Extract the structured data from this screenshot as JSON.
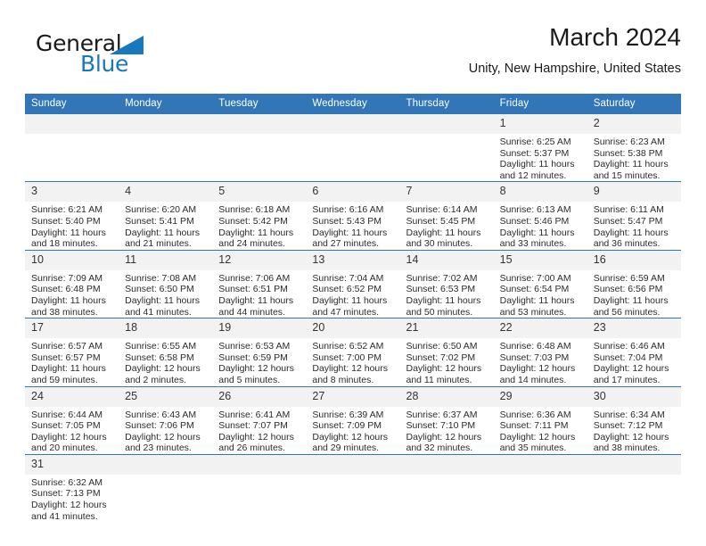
{
  "brand": {
    "name_top": "General",
    "name_bottom": "Blue",
    "flag_icon": "triangle-flag-icon",
    "color_primary": "#1878be",
    "color_text": "#1a1a1a"
  },
  "header": {
    "title": "March 2024",
    "subtitle": "Unity, New Hampshire, United States"
  },
  "theme": {
    "header_bg": "#3276b8",
    "daynum_bg": "#f2f2f2",
    "grid_line": "#3276b8"
  },
  "calendar": {
    "weekdays": [
      "Sunday",
      "Monday",
      "Tuesday",
      "Wednesday",
      "Thursday",
      "Friday",
      "Saturday"
    ],
    "labels": {
      "sunrise": "Sunrise:",
      "sunset": "Sunset:",
      "daylight": "Daylight:"
    },
    "weeks": [
      [
        {
          "day": "",
          "blank": true
        },
        {
          "day": "",
          "blank": true
        },
        {
          "day": "",
          "blank": true
        },
        {
          "day": "",
          "blank": true
        },
        {
          "day": "",
          "blank": true
        },
        {
          "day": "1",
          "sunrise": "Sunrise: 6:25 AM",
          "sunset": "Sunset: 5:37 PM",
          "daylight": "Daylight: 11 hours and 12 minutes."
        },
        {
          "day": "2",
          "sunrise": "Sunrise: 6:23 AM",
          "sunset": "Sunset: 5:38 PM",
          "daylight": "Daylight: 11 hours and 15 minutes."
        }
      ],
      [
        {
          "day": "3",
          "sunrise": "Sunrise: 6:21 AM",
          "sunset": "Sunset: 5:40 PM",
          "daylight": "Daylight: 11 hours and 18 minutes."
        },
        {
          "day": "4",
          "sunrise": "Sunrise: 6:20 AM",
          "sunset": "Sunset: 5:41 PM",
          "daylight": "Daylight: 11 hours and 21 minutes."
        },
        {
          "day": "5",
          "sunrise": "Sunrise: 6:18 AM",
          "sunset": "Sunset: 5:42 PM",
          "daylight": "Daylight: 11 hours and 24 minutes."
        },
        {
          "day": "6",
          "sunrise": "Sunrise: 6:16 AM",
          "sunset": "Sunset: 5:43 PM",
          "daylight": "Daylight: 11 hours and 27 minutes."
        },
        {
          "day": "7",
          "sunrise": "Sunrise: 6:14 AM",
          "sunset": "Sunset: 5:45 PM",
          "daylight": "Daylight: 11 hours and 30 minutes."
        },
        {
          "day": "8",
          "sunrise": "Sunrise: 6:13 AM",
          "sunset": "Sunset: 5:46 PM",
          "daylight": "Daylight: 11 hours and 33 minutes."
        },
        {
          "day": "9",
          "sunrise": "Sunrise: 6:11 AM",
          "sunset": "Sunset: 5:47 PM",
          "daylight": "Daylight: 11 hours and 36 minutes."
        }
      ],
      [
        {
          "day": "10",
          "sunrise": "Sunrise: 7:09 AM",
          "sunset": "Sunset: 6:48 PM",
          "daylight": "Daylight: 11 hours and 38 minutes."
        },
        {
          "day": "11",
          "sunrise": "Sunrise: 7:08 AM",
          "sunset": "Sunset: 6:50 PM",
          "daylight": "Daylight: 11 hours and 41 minutes."
        },
        {
          "day": "12",
          "sunrise": "Sunrise: 7:06 AM",
          "sunset": "Sunset: 6:51 PM",
          "daylight": "Daylight: 11 hours and 44 minutes."
        },
        {
          "day": "13",
          "sunrise": "Sunrise: 7:04 AM",
          "sunset": "Sunset: 6:52 PM",
          "daylight": "Daylight: 11 hours and 47 minutes."
        },
        {
          "day": "14",
          "sunrise": "Sunrise: 7:02 AM",
          "sunset": "Sunset: 6:53 PM",
          "daylight": "Daylight: 11 hours and 50 minutes."
        },
        {
          "day": "15",
          "sunrise": "Sunrise: 7:00 AM",
          "sunset": "Sunset: 6:54 PM",
          "daylight": "Daylight: 11 hours and 53 minutes."
        },
        {
          "day": "16",
          "sunrise": "Sunrise: 6:59 AM",
          "sunset": "Sunset: 6:56 PM",
          "daylight": "Daylight: 11 hours and 56 minutes."
        }
      ],
      [
        {
          "day": "17",
          "sunrise": "Sunrise: 6:57 AM",
          "sunset": "Sunset: 6:57 PM",
          "daylight": "Daylight: 11 hours and 59 minutes."
        },
        {
          "day": "18",
          "sunrise": "Sunrise: 6:55 AM",
          "sunset": "Sunset: 6:58 PM",
          "daylight": "Daylight: 12 hours and 2 minutes."
        },
        {
          "day": "19",
          "sunrise": "Sunrise: 6:53 AM",
          "sunset": "Sunset: 6:59 PM",
          "daylight": "Daylight: 12 hours and 5 minutes."
        },
        {
          "day": "20",
          "sunrise": "Sunrise: 6:52 AM",
          "sunset": "Sunset: 7:00 PM",
          "daylight": "Daylight: 12 hours and 8 minutes."
        },
        {
          "day": "21",
          "sunrise": "Sunrise: 6:50 AM",
          "sunset": "Sunset: 7:02 PM",
          "daylight": "Daylight: 12 hours and 11 minutes."
        },
        {
          "day": "22",
          "sunrise": "Sunrise: 6:48 AM",
          "sunset": "Sunset: 7:03 PM",
          "daylight": "Daylight: 12 hours and 14 minutes."
        },
        {
          "day": "23",
          "sunrise": "Sunrise: 6:46 AM",
          "sunset": "Sunset: 7:04 PM",
          "daylight": "Daylight: 12 hours and 17 minutes."
        }
      ],
      [
        {
          "day": "24",
          "sunrise": "Sunrise: 6:44 AM",
          "sunset": "Sunset: 7:05 PM",
          "daylight": "Daylight: 12 hours and 20 minutes."
        },
        {
          "day": "25",
          "sunrise": "Sunrise: 6:43 AM",
          "sunset": "Sunset: 7:06 PM",
          "daylight": "Daylight: 12 hours and 23 minutes."
        },
        {
          "day": "26",
          "sunrise": "Sunrise: 6:41 AM",
          "sunset": "Sunset: 7:07 PM",
          "daylight": "Daylight: 12 hours and 26 minutes."
        },
        {
          "day": "27",
          "sunrise": "Sunrise: 6:39 AM",
          "sunset": "Sunset: 7:09 PM",
          "daylight": "Daylight: 12 hours and 29 minutes."
        },
        {
          "day": "28",
          "sunrise": "Sunrise: 6:37 AM",
          "sunset": "Sunset: 7:10 PM",
          "daylight": "Daylight: 12 hours and 32 minutes."
        },
        {
          "day": "29",
          "sunrise": "Sunrise: 6:36 AM",
          "sunset": "Sunset: 7:11 PM",
          "daylight": "Daylight: 12 hours and 35 minutes."
        },
        {
          "day": "30",
          "sunrise": "Sunrise: 6:34 AM",
          "sunset": "Sunset: 7:12 PM",
          "daylight": "Daylight: 12 hours and 38 minutes."
        }
      ],
      [
        {
          "day": "31",
          "sunrise": "Sunrise: 6:32 AM",
          "sunset": "Sunset: 7:13 PM",
          "daylight": "Daylight: 12 hours and 41 minutes."
        },
        {
          "day": "",
          "blank": true
        },
        {
          "day": "",
          "blank": true
        },
        {
          "day": "",
          "blank": true
        },
        {
          "day": "",
          "blank": true
        },
        {
          "day": "",
          "blank": true
        },
        {
          "day": "",
          "blank": true
        }
      ]
    ]
  }
}
